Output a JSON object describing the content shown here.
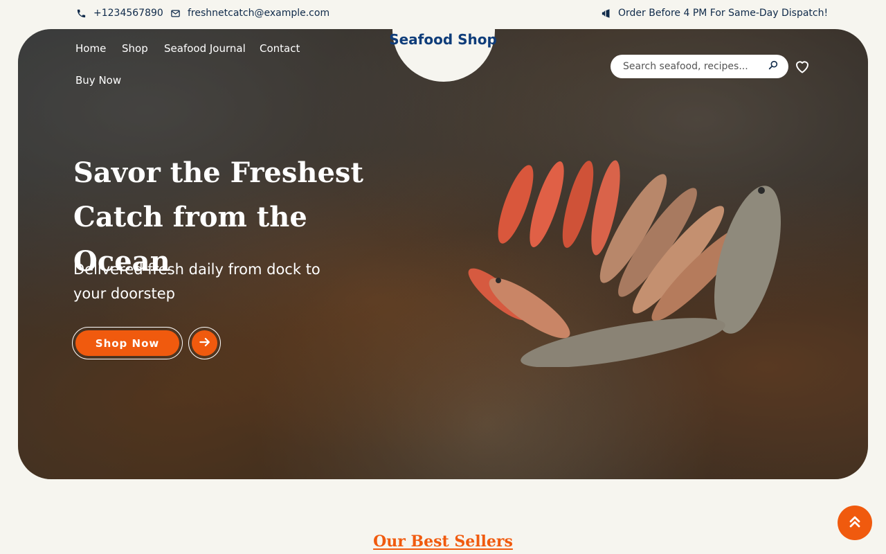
{
  "topbar": {
    "phone": "+1234567890",
    "email": "freshnetcatch@example.com",
    "promo": "Order Before 4 PM For Same-Day Dispatch!",
    "icons": [
      "phone-icon",
      "mail-icon",
      "megaphone-icon"
    ]
  },
  "header": {
    "site_title": "Seafood Shop",
    "nav": [
      "Home",
      "Shop",
      "Seafood Journal",
      "Contact",
      "Buy Now"
    ],
    "search_placeholder": "Search seafood, recipes...",
    "icons": [
      "search-icon",
      "heart-icon"
    ]
  },
  "hero": {
    "headline_line1": "Savor the Freshest",
    "headline_line2": "Catch from the Ocean",
    "subheadline": "Delivered fresh daily from dock to your doorstep",
    "cta_label": "Shop Now",
    "icons": [
      "arrow-right-icon"
    ]
  },
  "section": {
    "heading": "Our Best Sellers"
  },
  "colors": {
    "accent": "#f05a0e",
    "navy": "#0f2a4a",
    "title_blue": "#0f3d7a",
    "background": "#f6f5ef"
  },
  "scroll_top_icon": "double-chevron-up-icon"
}
